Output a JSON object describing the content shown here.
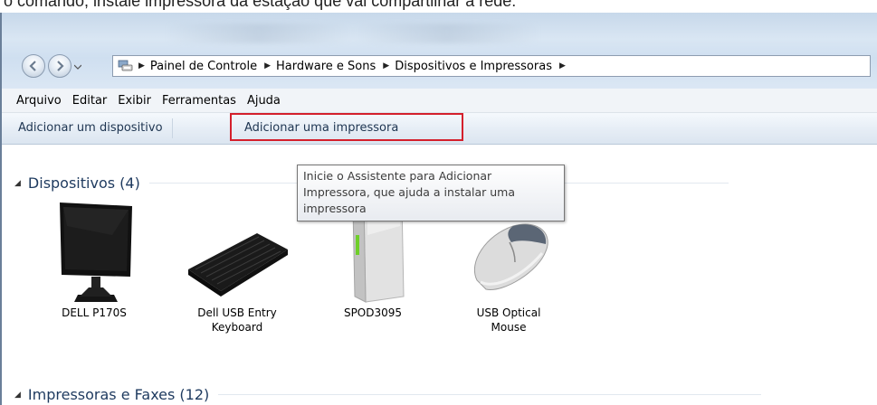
{
  "caption": "o comando, instale impressora da estação que vai compartilhar a rede:",
  "window": {
    "address": {
      "crumbs": [
        "Painel de Controle",
        "Hardware e Sons",
        "Dispositivos e Impressoras"
      ]
    },
    "menu": [
      "Arquivo",
      "Editar",
      "Exibir",
      "Ferramentas",
      "Ajuda"
    ],
    "commands": {
      "add_device": "Adicionar um dispositivo",
      "add_printer": "Adicionar uma impressora"
    },
    "tooltip": {
      "line1": "Inicie o Assistente para Adicionar",
      "line2": "Impressora, que ajuda a instalar uma",
      "line3": "impressora"
    },
    "groups": {
      "devices": "Dispositivos (4)",
      "printers": "Impressoras e Faxes (12)"
    },
    "devices": [
      {
        "name": "DELL P170S",
        "icon": "monitor-icon"
      },
      {
        "name": "Dell USB Entry Keyboard",
        "line1": "Dell USB Entry",
        "line2": "Keyboard",
        "icon": "keyboard-icon"
      },
      {
        "name": "SPOD3095",
        "icon": "computer-tower-icon"
      },
      {
        "name": "USB Optical Mouse",
        "line1": "USB Optical",
        "line2": "Mouse",
        "icon": "mouse-icon"
      }
    ]
  },
  "colors": {
    "highlight": "#d4202c",
    "header_text": "#1e3a5f",
    "command_text": "#1e3551"
  }
}
